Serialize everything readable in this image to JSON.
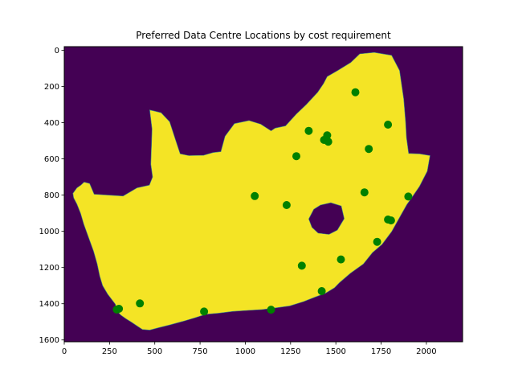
{
  "chart_data": {
    "type": "scatter",
    "title": "Preferred Data Centre Locations by cost requirement",
    "xlabel": "",
    "ylabel": "",
    "xlim": [
      0,
      2200
    ],
    "ylim": [
      1610,
      -20
    ],
    "y_inverted": true,
    "grid": false,
    "x_ticks": [
      0,
      250,
      500,
      750,
      1000,
      1250,
      1500,
      1750,
      2000
    ],
    "y_ticks": [
      0,
      200,
      400,
      600,
      800,
      1000,
      1200,
      1400,
      1600
    ],
    "background": {
      "type": "image-mask",
      "inside_color": "#f4e425",
      "outside_color": "#440154",
      "outline": [
        [
          48,
          790
        ],
        [
          70,
          760
        ],
        [
          92,
          745
        ],
        [
          110,
          728
        ],
        [
          140,
          736
        ],
        [
          165,
          795
        ],
        [
          240,
          800
        ],
        [
          325,
          805
        ],
        [
          402,
          760
        ],
        [
          470,
          745
        ],
        [
          488,
          700
        ],
        [
          478,
          630
        ],
        [
          480,
          575
        ],
        [
          482,
          515
        ],
        [
          485,
          435
        ],
        [
          472,
          330
        ],
        [
          495,
          335
        ],
        [
          535,
          345
        ],
        [
          582,
          395
        ],
        [
          618,
          505
        ],
        [
          640,
          572
        ],
        [
          688,
          582
        ],
        [
          770,
          580
        ],
        [
          822,
          565
        ],
        [
          865,
          560
        ],
        [
          888,
          475
        ],
        [
          940,
          405
        ],
        [
          1020,
          388
        ],
        [
          1085,
          408
        ],
        [
          1142,
          445
        ],
        [
          1165,
          430
        ],
        [
          1222,
          418
        ],
        [
          1282,
          352
        ],
        [
          1337,
          300
        ],
        [
          1400,
          232
        ],
        [
          1432,
          184
        ],
        [
          1452,
          145
        ],
        [
          1510,
          112
        ],
        [
          1582,
          68
        ],
        [
          1632,
          20
        ],
        [
          1712,
          12
        ],
        [
          1808,
          28
        ],
        [
          1852,
          112
        ],
        [
          1875,
          270
        ],
        [
          1885,
          395
        ],
        [
          1890,
          482
        ],
        [
          1902,
          570
        ],
        [
          1962,
          572
        ],
        [
          2020,
          582
        ],
        [
          2005,
          668
        ],
        [
          1962,
          752
        ],
        [
          1922,
          810
        ],
        [
          1892,
          852
        ],
        [
          1855,
          918
        ],
        [
          1808,
          1002
        ],
        [
          1755,
          1072
        ],
        [
          1702,
          1118
        ],
        [
          1652,
          1180
        ],
        [
          1580,
          1232
        ],
        [
          1522,
          1282
        ],
        [
          1492,
          1312
        ],
        [
          1442,
          1342
        ],
        [
          1388,
          1362
        ],
        [
          1322,
          1388
        ],
        [
          1245,
          1412
        ],
        [
          1172,
          1422
        ],
        [
          1092,
          1432
        ],
        [
          1012,
          1437
        ],
        [
          932,
          1442
        ],
        [
          852,
          1452
        ],
        [
          782,
          1458
        ],
        [
          722,
          1477
        ],
        [
          655,
          1497
        ],
        [
          582,
          1517
        ],
        [
          522,
          1532
        ],
        [
          472,
          1545
        ],
        [
          432,
          1542
        ],
        [
          402,
          1522
        ],
        [
          372,
          1502
        ],
        [
          340,
          1482
        ],
        [
          312,
          1462
        ],
        [
          292,
          1440
        ],
        [
          282,
          1402
        ],
        [
          240,
          1347
        ],
        [
          212,
          1300
        ],
        [
          196,
          1247
        ],
        [
          182,
          1180
        ],
        [
          162,
          1110
        ],
        [
          140,
          1050
        ],
        [
          108,
          960
        ],
        [
          90,
          900
        ],
        [
          70,
          850
        ],
        [
          52,
          815
        ]
      ],
      "hole": [
        [
          1350,
          932
        ],
        [
          1378,
          878
        ],
        [
          1415,
          855
        ],
        [
          1472,
          842
        ],
        [
          1530,
          860
        ],
        [
          1546,
          930
        ],
        [
          1508,
          993
        ],
        [
          1462,
          1017
        ],
        [
          1402,
          1010
        ],
        [
          1368,
          978
        ]
      ]
    },
    "series": [
      {
        "color": "#008000",
        "points": [
          [
            1608,
            232
          ],
          [
            1788,
            411
          ],
          [
            1350,
            445
          ],
          [
            1452,
            470
          ],
          [
            1435,
            495
          ],
          [
            1458,
            505
          ],
          [
            1682,
            545
          ],
          [
            1282,
            585
          ],
          [
            1052,
            805
          ],
          [
            1658,
            785
          ],
          [
            1900,
            808
          ],
          [
            1228,
            855
          ],
          [
            1788,
            935
          ],
          [
            1805,
            940
          ],
          [
            1728,
            1058
          ],
          [
            1312,
            1190
          ],
          [
            1528,
            1155
          ],
          [
            1422,
            1330
          ],
          [
            418,
            1398
          ],
          [
            302,
            1428
          ],
          [
            290,
            1432
          ],
          [
            772,
            1443
          ],
          [
            1142,
            1433
          ]
        ]
      }
    ]
  }
}
